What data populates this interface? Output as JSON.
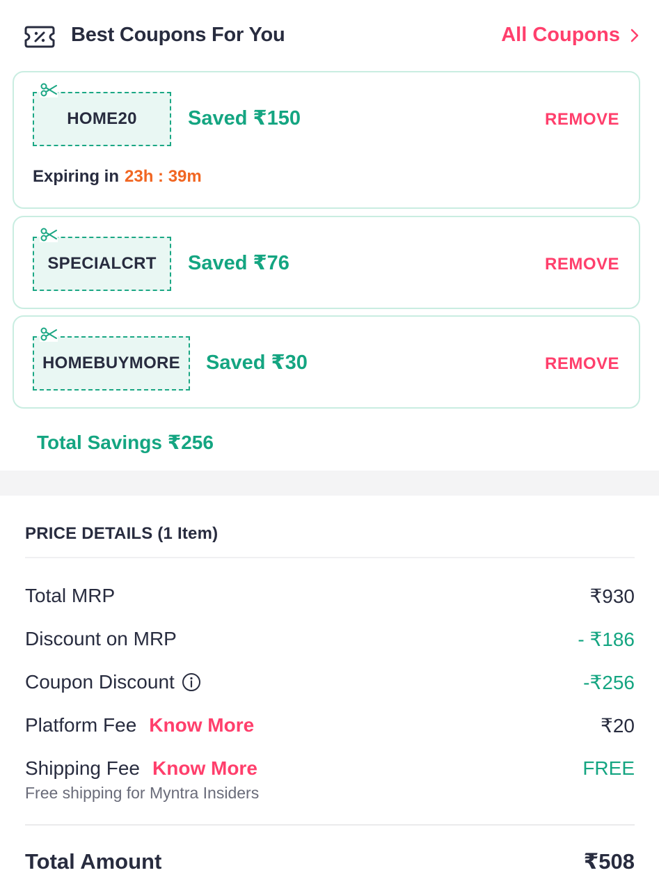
{
  "header": {
    "title": "Best Coupons For You",
    "all_coupons_label": "All Coupons"
  },
  "coupons": [
    {
      "code": "HOME20",
      "saved": "Saved ₹150",
      "remove_label": "REMOVE",
      "expiry_label": "Expiring in",
      "expiry_time": "23h : 39m"
    },
    {
      "code": "SPECIALCRT",
      "saved": "Saved ₹76",
      "remove_label": "REMOVE"
    },
    {
      "code": "HOMEBUYMORE",
      "saved": "Saved ₹30",
      "remove_label": "REMOVE"
    }
  ],
  "total_savings": "Total Savings ₹256",
  "price_details": {
    "heading": "PRICE DETAILS (1 Item)",
    "rows": [
      {
        "label": "Total MRP",
        "value": "₹930"
      },
      {
        "label": "Discount on MRP",
        "value": "- ₹186"
      },
      {
        "label": "Coupon Discount",
        "value": "-₹256"
      },
      {
        "label": "Platform Fee",
        "link": "Know More",
        "value": "₹20"
      },
      {
        "label": "Shipping Fee",
        "link": "Know More",
        "value": "FREE",
        "note": "Free shipping for Myntra Insiders"
      }
    ],
    "total_label": "Total Amount",
    "total_value": "₹508"
  },
  "colors": {
    "accent_pink": "#ff3f6c",
    "saving_green": "#14a581",
    "expiry_orange": "#f16622",
    "card_border": "#c9ede1",
    "code_bg": "#e9f7f3"
  }
}
